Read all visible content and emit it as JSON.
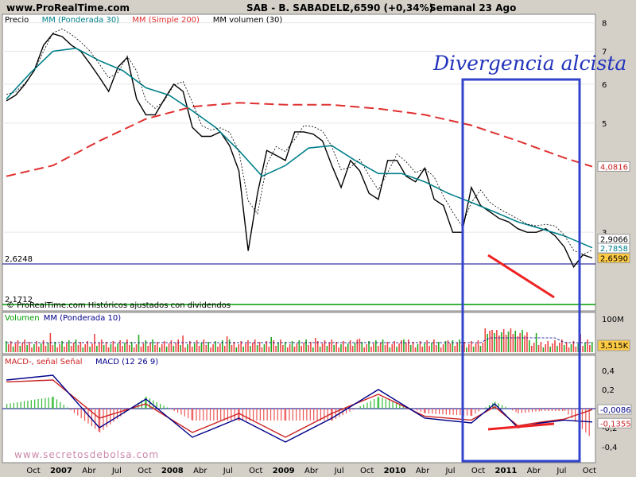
{
  "header": {
    "site": "www.ProRealTime.com",
    "instrument": "SAB - B. SABADELL",
    "price_change": "2,6590 (+0,34%)",
    "period": "Semanal 23 Ago"
  },
  "price_panel": {
    "legend": [
      {
        "label": "Precio",
        "color": "#000000"
      },
      {
        "label": "MM (Ponderada 30)",
        "color": "#00808a"
      },
      {
        "label": "MM (Simple 200)",
        "color": "#e03030"
      },
      {
        "label": "MM volumen (30)",
        "color": "#000000"
      }
    ],
    "y_ticks": [
      "8",
      "7",
      "6",
      "5",
      "3"
    ],
    "markers": {
      "left_level": "2,6248",
      "left_low": "2,1712"
    },
    "right_labels": [
      {
        "text": "4,0816",
        "color": "#cc2222",
        "bg": "#ffffff",
        "y": 4.0816
      },
      {
        "text": "2,9066",
        "color": "#000000",
        "bg": "#ffffff",
        "y": 2.9066
      },
      {
        "text": "2,7858",
        "color": "#00808a",
        "bg": "#ffffff",
        "y": 2.7858
      },
      {
        "text": "2,6590",
        "color": "#000000",
        "bg": "#ffcc44",
        "y": 2.659
      }
    ],
    "footer_note": "© ProRealTime.com Históricos ajustados con dividendos",
    "annotation": "Divergencia alcista"
  },
  "volume_panel": {
    "legend": [
      {
        "label": "Volumen",
        "color": "#009900"
      },
      {
        "label": "MM (Ponderada 10)",
        "color": "#000088"
      }
    ],
    "y_ticks": [
      "100M"
    ],
    "right_label": "3,515K"
  },
  "macd_panel": {
    "legend": [
      {
        "label": "MACD-, señal Señal",
        "color": "#cc2222"
      },
      {
        "label": "MACD (12 26 9)",
        "color": "#000088"
      }
    ],
    "y_ticks": [
      "0,4",
      "0,2",
      "-0,2",
      "-0,4"
    ],
    "right_labels": [
      "-0,0086",
      "-0,1355"
    ]
  },
  "x_axis": {
    "ticks": [
      {
        "label": "Oct",
        "bold": false
      },
      {
        "label": "2007",
        "bold": true
      },
      {
        "label": "Abr",
        "bold": false
      },
      {
        "label": "Jul",
        "bold": false
      },
      {
        "label": "Oct",
        "bold": false
      },
      {
        "label": "2008",
        "bold": true
      },
      {
        "label": "Abr",
        "bold": false
      },
      {
        "label": "Jul",
        "bold": false
      },
      {
        "label": "Oct",
        "bold": false
      },
      {
        "label": "2009",
        "bold": true
      },
      {
        "label": "Abr",
        "bold": false
      },
      {
        "label": "Jul",
        "bold": false
      },
      {
        "label": "Oct",
        "bold": false
      },
      {
        "label": "2010",
        "bold": true
      },
      {
        "label": "Abr",
        "bold": false
      },
      {
        "label": "Jul",
        "bold": false
      },
      {
        "label": "Oct",
        "bold": false
      },
      {
        "label": "2011",
        "bold": true
      },
      {
        "label": "Abr",
        "bold": false
      },
      {
        "label": "Jul",
        "bold": false
      },
      {
        "label": "Oct",
        "bold": false
      }
    ]
  },
  "watermark": "www.secretosdebolsa.com",
  "chart_data": {
    "type": "line",
    "title": "SAB - B. SABADELL",
    "y_scale": "log",
    "ylim": [
      2.1,
      8.2
    ],
    "series": [
      {
        "name": "Precio",
        "x": [
          0,
          4,
          8,
          12,
          16,
          20,
          24,
          28,
          32,
          36,
          40,
          44,
          48,
          52,
          56,
          60,
          64,
          68,
          72,
          76,
          80,
          84,
          88,
          92,
          96,
          100,
          104,
          108,
          112,
          116,
          120,
          124,
          128,
          132,
          136,
          140,
          144,
          148,
          152,
          156,
          160,
          164,
          168,
          172,
          176,
          180,
          184,
          188,
          192,
          196,
          200,
          204,
          208,
          212,
          216,
          220,
          224,
          228,
          232,
          236,
          240,
          244,
          248,
          252
        ],
        "values": [
          5.55,
          5.7,
          6.0,
          6.4,
          7.2,
          7.6,
          7.5,
          7.2,
          7.0,
          6.6,
          6.2,
          5.8,
          6.5,
          6.8,
          5.6,
          5.2,
          5.2,
          5.6,
          6.0,
          5.8,
          4.9,
          4.7,
          4.7,
          4.8,
          4.5,
          4.0,
          2.75,
          3.6,
          4.4,
          4.3,
          4.2,
          4.8,
          4.8,
          4.75,
          4.6,
          4.1,
          3.7,
          4.2,
          4.0,
          3.6,
          3.5,
          4.2,
          4.2,
          3.9,
          3.8,
          4.05,
          3.5,
          3.4,
          3.0,
          3.0,
          3.7,
          3.4,
          3.3,
          3.2,
          3.15,
          3.05,
          3.0,
          3.0,
          3.05,
          2.95,
          2.8,
          2.55,
          2.7,
          2.66
        ]
      },
      {
        "name": "MM (Ponderada 30)",
        "x": [
          0,
          10,
          20,
          30,
          40,
          50,
          60,
          70,
          80,
          90,
          100,
          110,
          120,
          130,
          140,
          150,
          160,
          170,
          180,
          190,
          200,
          210,
          220,
          230,
          240,
          252
        ],
        "values": [
          5.6,
          6.3,
          7.0,
          7.1,
          6.7,
          6.4,
          5.9,
          5.7,
          5.3,
          4.9,
          4.4,
          3.9,
          4.1,
          4.45,
          4.5,
          4.2,
          3.95,
          3.95,
          3.8,
          3.6,
          3.45,
          3.3,
          3.15,
          3.05,
          2.95,
          2.79
        ]
      },
      {
        "name": "MM (Simple 200)",
        "x": [
          0,
          20,
          40,
          60,
          80,
          100,
          120,
          140,
          160,
          180,
          200,
          220,
          240,
          252
        ],
        "values": [
          3.9,
          4.1,
          4.6,
          5.1,
          5.4,
          5.5,
          5.45,
          5.45,
          5.35,
          5.2,
          4.95,
          4.6,
          4.25,
          4.08
        ]
      },
      {
        "name": "MACD (12 26 9)",
        "x": [
          0,
          20,
          40,
          60,
          80,
          100,
          120,
          140,
          160,
          180,
          200,
          210,
          220,
          230,
          240,
          252
        ],
        "values": [
          0.3,
          0.35,
          -0.2,
          0.1,
          -0.3,
          -0.1,
          -0.35,
          -0.1,
          0.2,
          -0.1,
          -0.15,
          0.05,
          -0.2,
          -0.15,
          -0.12,
          -0.14
        ]
      },
      {
        "name": "Señal",
        "x": [
          0,
          20,
          40,
          60,
          80,
          100,
          120,
          140,
          160,
          180,
          200,
          210,
          220,
          230,
          240,
          252
        ],
        "values": [
          0.28,
          0.3,
          -0.1,
          0.05,
          -0.25,
          -0.05,
          -0.3,
          -0.05,
          0.15,
          -0.08,
          -0.12,
          0.02,
          -0.18,
          -0.14,
          -0.11,
          -0.01
        ]
      }
    ]
  }
}
